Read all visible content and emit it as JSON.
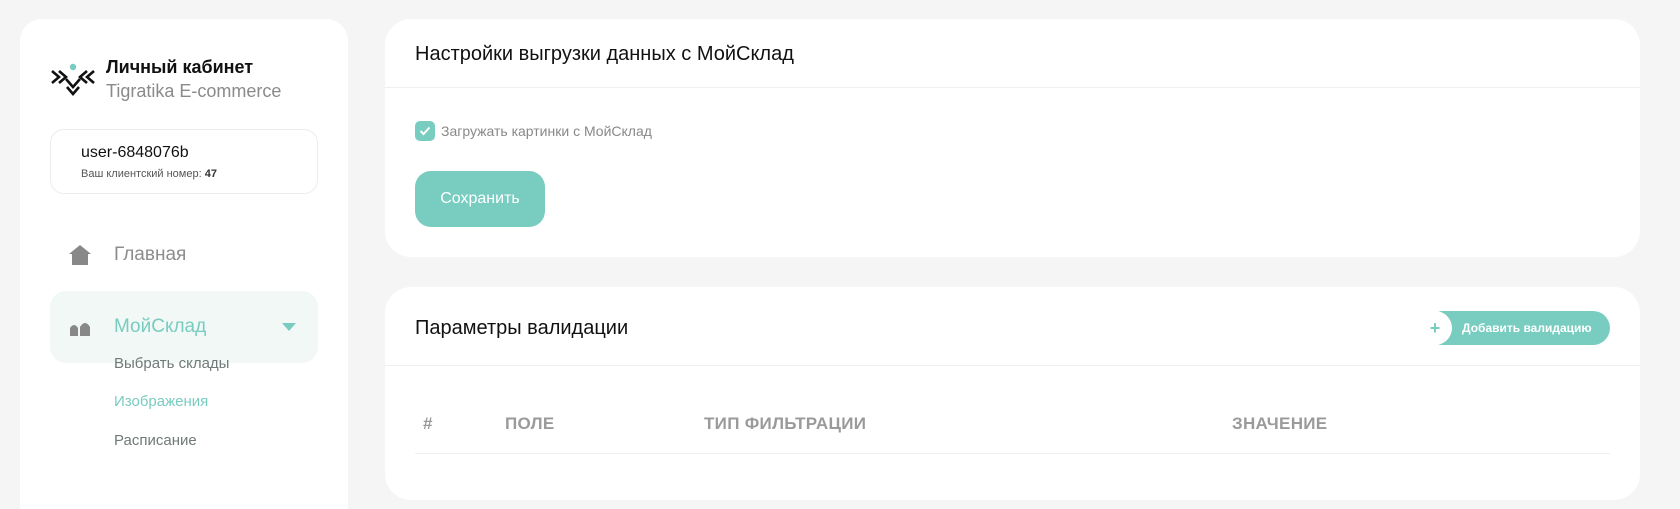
{
  "brand": {
    "title": "Личный кабинет",
    "subtitle": "Tigratika E-commerce"
  },
  "user": {
    "name": "user-6848076b",
    "client_label": "Ваш клиентский номер:",
    "client_number": "47"
  },
  "nav": {
    "home_label": "Главная",
    "moysklad_label": "МойСклад",
    "sub_items": [
      {
        "label": "Выбрать склады",
        "active": false
      },
      {
        "label": "Изображения",
        "active": true
      },
      {
        "label": "Расписание",
        "active": false
      }
    ]
  },
  "export_settings": {
    "title": "Настройки выгрузки данных с МойСклад",
    "checkbox_label": "Загружать картинки с МойСклад",
    "checkbox_checked": true,
    "save_label": "Сохранить"
  },
  "validation": {
    "title": "Параметры валидации",
    "add_plus": "+",
    "add_label": "Добавить валидацию",
    "columns": [
      "#",
      "ПОЛЕ",
      "ТИП ФИЛЬТРАЦИИ",
      "ЗНАЧЕНИЕ"
    ]
  },
  "colors": {
    "accent": "#79ccc0",
    "background": "#f5f5f5",
    "card": "#ffffff",
    "active_nav_bg": "#f1f8f6"
  }
}
